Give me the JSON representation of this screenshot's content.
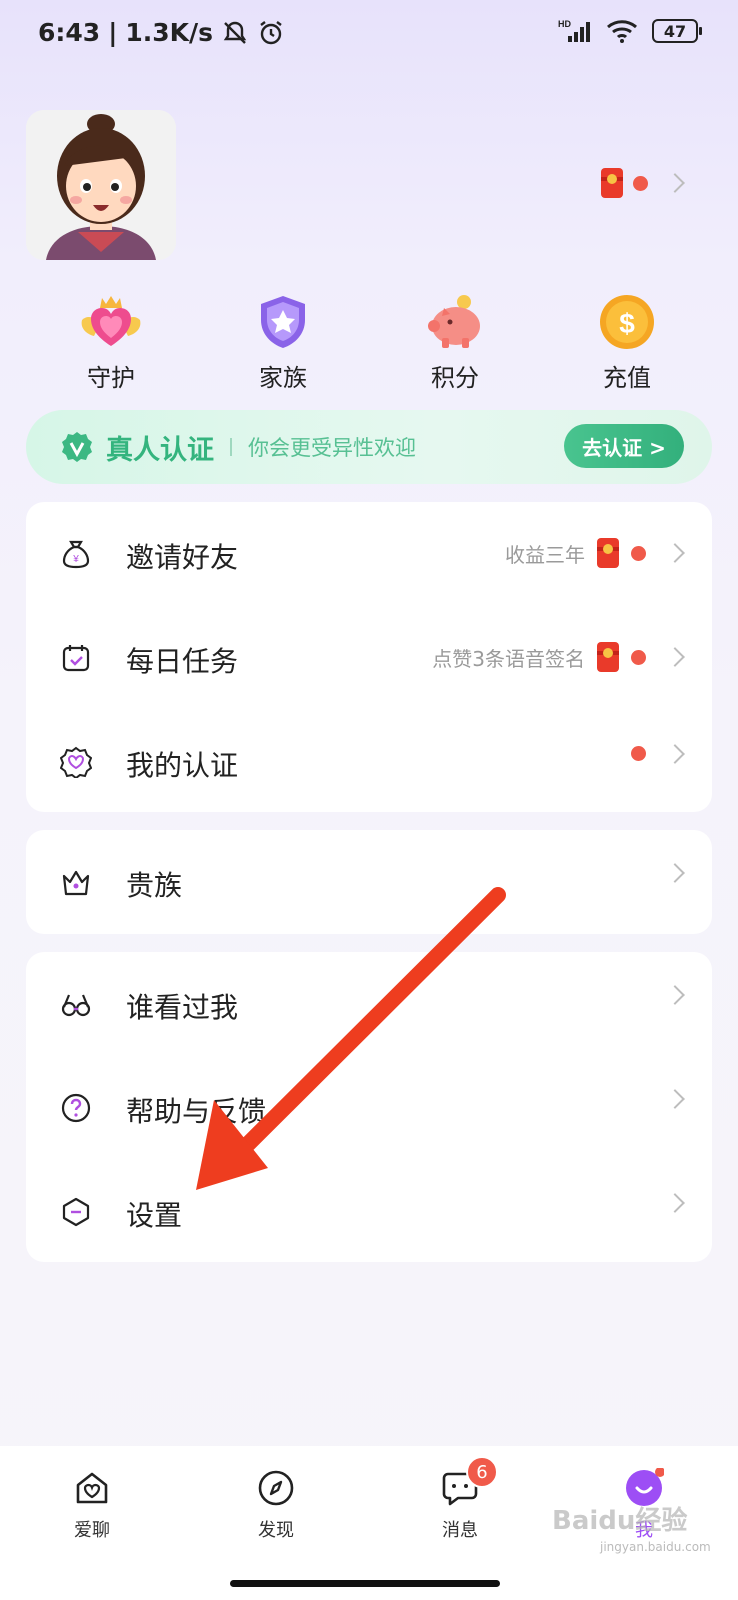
{
  "status_bar": {
    "time": "6:43",
    "speed": "1.3K/s",
    "battery": "47"
  },
  "profile": {
    "avatar": "cartoon-woman-avatar"
  },
  "quick_actions": [
    {
      "label": "守护",
      "icon": "guard-heart-icon"
    },
    {
      "label": "家族",
      "icon": "family-shield-icon"
    },
    {
      "label": "积分",
      "icon": "piggy-bank-icon"
    },
    {
      "label": "充值",
      "icon": "coin-icon"
    }
  ],
  "verify_banner": {
    "title": "真人认证",
    "subtitle": "你会更受异性欢迎",
    "button": "去认证 >"
  },
  "menu_group1": [
    {
      "label": "邀请好友",
      "hint": "收益三年",
      "icon": "money-bag-icon"
    },
    {
      "label": "每日任务",
      "hint": "点赞3条语音签名",
      "icon": "calendar-check-icon"
    },
    {
      "label": "我的认证",
      "hint": "",
      "icon": "badge-heart-icon"
    }
  ],
  "menu_group2": [
    {
      "label": "贵族",
      "icon": "crown-icon"
    }
  ],
  "menu_group3": [
    {
      "label": "谁看过我",
      "icon": "glasses-icon"
    },
    {
      "label": "帮助与反馈",
      "icon": "help-circle-icon"
    },
    {
      "label": "设置",
      "icon": "hexagon-settings-icon"
    }
  ],
  "bottom_nav": [
    {
      "label": "爱聊",
      "icon": "home-heart-icon"
    },
    {
      "label": "发现",
      "icon": "compass-icon"
    },
    {
      "label": "消息",
      "icon": "chat-icon",
      "badge": "6"
    },
    {
      "label": "我",
      "icon": "me-smile-icon"
    }
  ],
  "watermark": {
    "text": "Baidu经验",
    "sub": "jingyan.baidu.com"
  },
  "colors": {
    "accent": "#9d4ef5",
    "green": "#34b47e",
    "red": "#f05a4a",
    "arrow": "#ee3d1f"
  }
}
